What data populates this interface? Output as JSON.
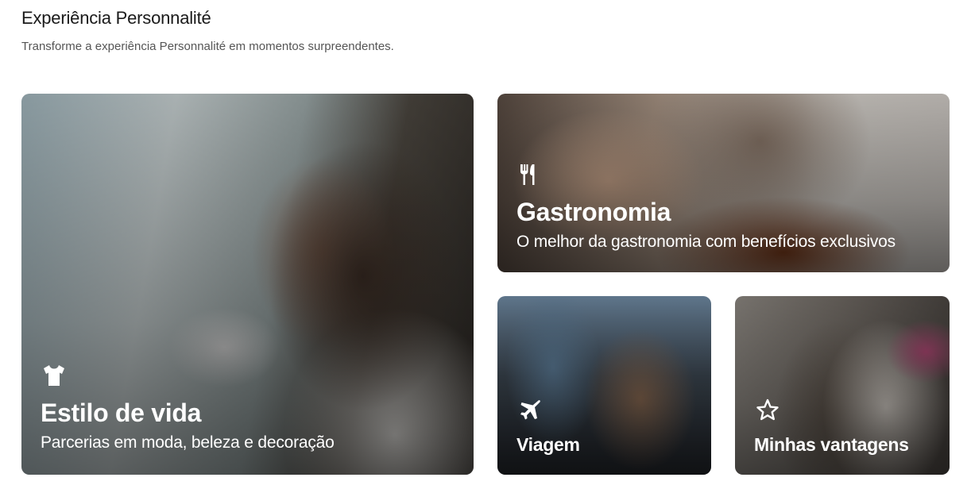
{
  "header": {
    "title": "Experiência Personnalité",
    "subtitle": "Transforme a experiência Personnalité em momentos surpreendentes."
  },
  "cards": [
    {
      "id": "lifestyle",
      "icon": "tshirt-icon",
      "title": "Estilo de vida",
      "description": "Parcerias em moda, beleza e decoração"
    },
    {
      "id": "gastronomy",
      "icon": "fork-knife-icon",
      "title": "Gastronomia",
      "description": "O melhor da gastronomia com benefícios exclusivos"
    },
    {
      "id": "travel",
      "icon": "airplane-icon",
      "title": "Viagem"
    },
    {
      "id": "benefits",
      "icon": "star-icon",
      "title": "Minhas vantagens"
    }
  ],
  "colors": {
    "text_on_card": "#ffffff",
    "title": "#1a1a1a",
    "subtitle": "#555555"
  }
}
